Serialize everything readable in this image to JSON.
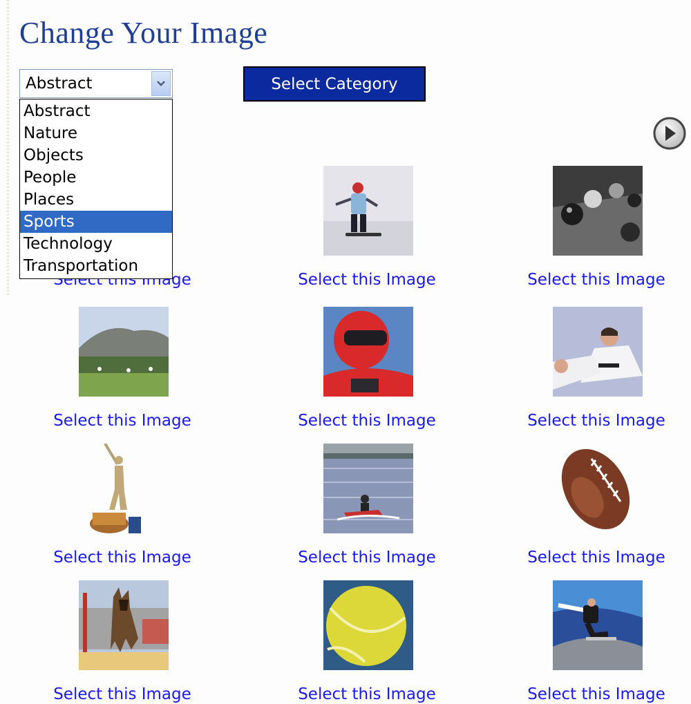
{
  "page": {
    "title": "Change Your Image"
  },
  "category_select": {
    "selected": "Abstract",
    "options": [
      "Abstract",
      "Nature",
      "Objects",
      "People",
      "Places",
      "Sports",
      "Technology",
      "Transportation"
    ],
    "highlighted": "Sports"
  },
  "select_category_button": "Select Category",
  "next_icon": "circle-play-arrow-icon",
  "images": [
    {
      "subject": "",
      "link": "Select this Image"
    },
    {
      "subject": "skier-on-snow",
      "link": "Select this Image"
    },
    {
      "subject": "billiard-balls",
      "link": "Select this Image"
    },
    {
      "subject": "sports-field-with-mountain",
      "link": "Select this Image"
    },
    {
      "subject": "rider-in-red-helmet",
      "link": "Select this Image"
    },
    {
      "subject": "karate-kick",
      "link": "Select this Image"
    },
    {
      "subject": "baseball-trophy",
      "link": "Select this Image"
    },
    {
      "subject": "jet-ski-on-water",
      "link": "Select this Image"
    },
    {
      "subject": "american-football",
      "link": "Select this Image"
    },
    {
      "subject": "dog-jumping-hurdle",
      "link": "Select this Image"
    },
    {
      "subject": "tennis-ball",
      "link": "Select this Image"
    },
    {
      "subject": "skateboarder-in-ramp",
      "link": "Select this Image"
    }
  ]
}
